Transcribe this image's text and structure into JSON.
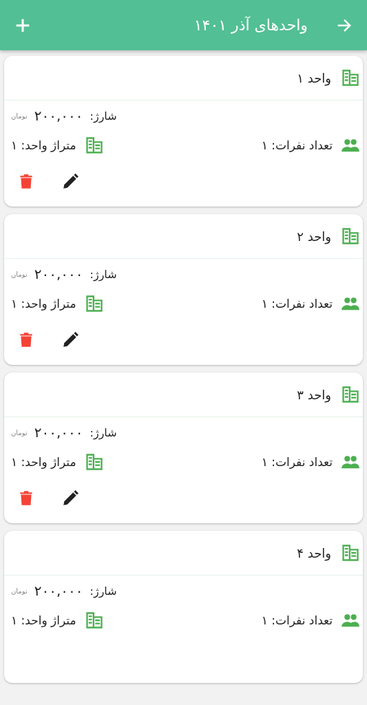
{
  "app_bar": {
    "title": "واحدهای آذر ۱۴۰۱"
  },
  "units": [
    {
      "name": "واحد ۱",
      "charge_label": "شارژ:",
      "charge": "۲۰۰,۰۰۰",
      "currency": "تومان",
      "residents": "تعداد نفرات: ۱",
      "area": "متراژ واحد: ۱",
      "actions": [
        {
          "kind": "edit"
        },
        {
          "kind": "delete"
        }
      ]
    },
    {
      "name": "واحد ۲",
      "charge_label": "شارژ:",
      "charge": "۲۰۰,۰۰۰",
      "currency": "تومان",
      "residents": "تعداد نفرات: ۱",
      "area": "متراژ واحد: ۱",
      "actions": [
        {
          "kind": "edit"
        },
        {
          "kind": "delete"
        }
      ]
    },
    {
      "name": "واحد ۳",
      "charge_label": "شارژ:",
      "charge": "۲۰۰,۰۰۰",
      "currency": "تومان",
      "residents": "تعداد نفرات: ۱",
      "area": "متراژ واحد: ۱",
      "actions": [
        {
          "kind": "edit"
        },
        {
          "kind": "delete"
        }
      ]
    },
    {
      "name": "واحد ۴",
      "charge_label": "شارژ:",
      "charge": "۲۰۰,۰۰۰",
      "currency": "تومان",
      "residents": "تعداد نفرات: ۱",
      "area": "متراژ واحد: ۱"
    }
  ]
}
